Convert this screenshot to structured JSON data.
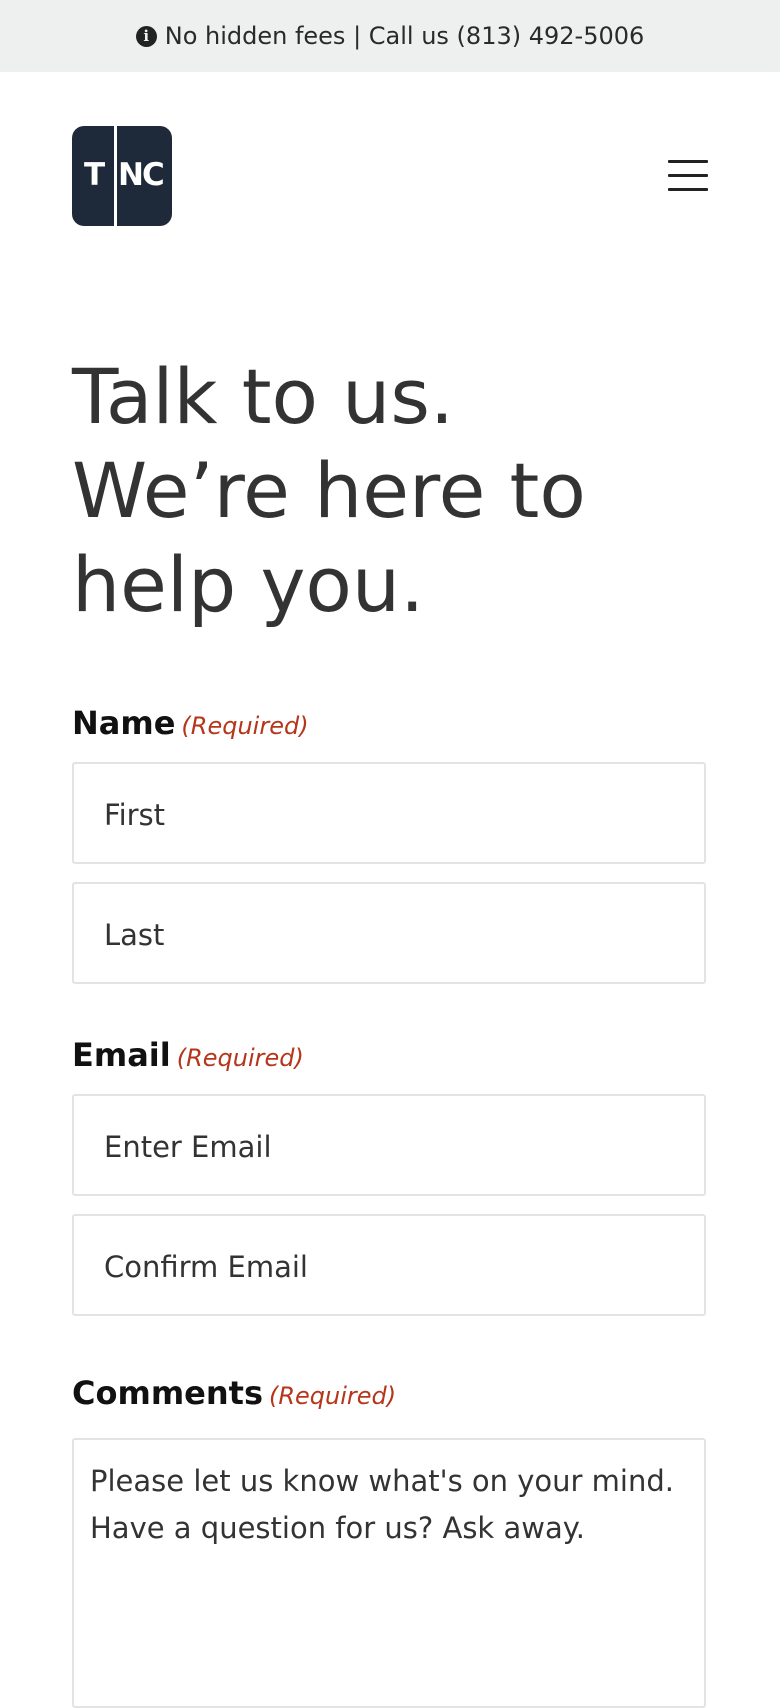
{
  "topbar": {
    "info_icon": "info-circle-icon",
    "text": "No hidden fees | Call us (813) 492-5006"
  },
  "header": {
    "logo_letters": [
      "T",
      "N",
      "C"
    ],
    "menu_icon": "hamburger-menu-icon"
  },
  "hero": {
    "lines": [
      "Talk to us.",
      "We’re here to",
      "help you."
    ]
  },
  "form": {
    "name": {
      "label": "Name",
      "required": "(Required)",
      "first_placeholder": "First",
      "last_placeholder": "Last"
    },
    "email": {
      "label": "Email",
      "required": "(Required)",
      "email_placeholder": "Enter Email",
      "confirm_placeholder": "Confirm Email"
    },
    "comments": {
      "label": "Comments",
      "required": "(Required)",
      "placeholder_line1": "Please let us know what's on your mind.",
      "placeholder_line2": "Have a question for us? Ask away."
    }
  },
  "colors": {
    "topbar_bg": "#edf0ee",
    "logo_bg": "#1e2a3a",
    "required_red": "#b5361b",
    "heading": "#333333"
  }
}
